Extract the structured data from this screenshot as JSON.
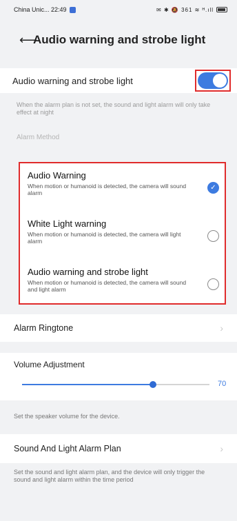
{
  "status_bar": {
    "carrier_time": "China Unic... 22:49",
    "right_icons": "✉ ✱ 🔕 361 ≋ ᴴ.ıll"
  },
  "header": {
    "back_icon": "arrow-left",
    "title": "Audio warning and strobe light"
  },
  "toggle_row": {
    "label": "Audio warning and strobe light",
    "enabled": true
  },
  "hint": "When the alarm plan is not set, the sound and light alarm will only take effect at night",
  "alarm_method_label": "Alarm Method",
  "methods": [
    {
      "title": "Audio Warning",
      "desc": "When motion or humanoid is detected, the camera will sound alarm",
      "selected": true
    },
    {
      "title": "White Light warning",
      "desc": "When motion or humanoid is detected, the camera will light alarm",
      "selected": false
    },
    {
      "title": "Audio warning and strobe light",
      "desc": "When motion or humanoid is detected, the camera will sound and light alarm",
      "selected": false
    }
  ],
  "alarm_ringtone": {
    "label": "Alarm Ringtone"
  },
  "volume": {
    "label": "Volume Adjustment",
    "value": "70",
    "level": 70,
    "hint": "Set the speaker volume for the device."
  },
  "plan": {
    "label": "Sound And Light Alarm Plan",
    "hint": "Set the sound and light alarm plan, and the device will only trigger the sound and light alarm within the time period"
  },
  "colors": {
    "accent": "#3d7be0",
    "highlight_border": "#e02b2b",
    "background": "#f1f2f4"
  }
}
